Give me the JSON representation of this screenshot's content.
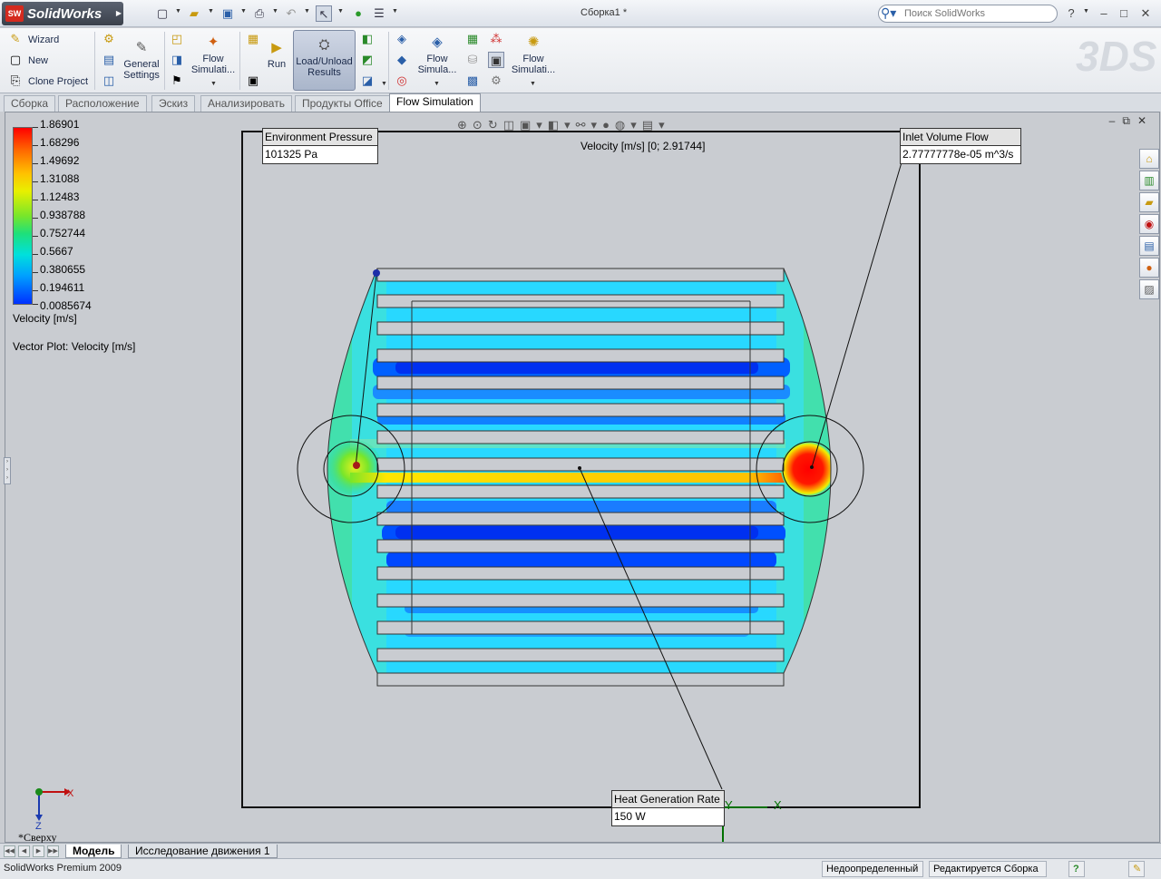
{
  "app": {
    "brand": "SolidWorks",
    "document_title": "Сборка1 *",
    "search_placeholder": "Поиск SolidWorks",
    "status_text": "SolidWorks Premium 2009"
  },
  "command_manager": {
    "wizard": "Wizard",
    "new": "New",
    "clone_project": "Clone Project",
    "general_settings_line1": "General",
    "general_settings_line2": "Settings",
    "flow_simulation_1_line1": "Flow",
    "flow_simulation_1_line2": "Simulati...",
    "run": "Run",
    "load_unload_line1": "Load/Unload",
    "load_unload_line2": "Results",
    "flow_simulation_2_line1": "Flow",
    "flow_simulation_2_line2": "Simula...",
    "flow_simulation_3_line1": "Flow",
    "flow_simulation_3_line2": "Simulati..."
  },
  "tabs": [
    {
      "label": "Сборка"
    },
    {
      "label": "Расположение"
    },
    {
      "label": "Эскиз"
    },
    {
      "label": "Анализировать"
    },
    {
      "label": "Продукты Office"
    },
    {
      "label": "Flow Simulation",
      "active": true
    }
  ],
  "legend": {
    "values": [
      "1.86901",
      "1.68296",
      "1.49692",
      "1.31088",
      "1.12483",
      "0.938788",
      "0.752744",
      "0.5667",
      "0.380655",
      "0.194611",
      "0.0085674"
    ],
    "title": "Velocity [m/s]",
    "vector_plot": "Vector Plot: Velocity [m/s]"
  },
  "plot": {
    "title": "Velocity [m/s] [0; 2.91744]",
    "range": [
      0,
      2.91744
    ],
    "colors": {
      "high": "#ff0000",
      "mid": "#e8f000",
      "low": "#0030ff"
    }
  },
  "callouts": {
    "environment_pressure": {
      "header": "Environment Pressure",
      "value": "101325 Pa"
    },
    "inlet_volume_flow": {
      "header": "Inlet Volume Flow",
      "value": "2.77777778e-05 m^3/s"
    },
    "heat_generation_rate": {
      "header": "Heat Generation Rate",
      "value": "150 W"
    }
  },
  "triad": {
    "x": "X",
    "y": "Y",
    "z": "Z"
  },
  "view_name": "*Сверху",
  "model_tabs": [
    {
      "label": "Модель",
      "active": true
    },
    {
      "label": "Исследование движения 1"
    }
  ],
  "status_cells": {
    "definition": "Недоопределенный",
    "editing": "Редактируется Сборка",
    "help": "?"
  }
}
